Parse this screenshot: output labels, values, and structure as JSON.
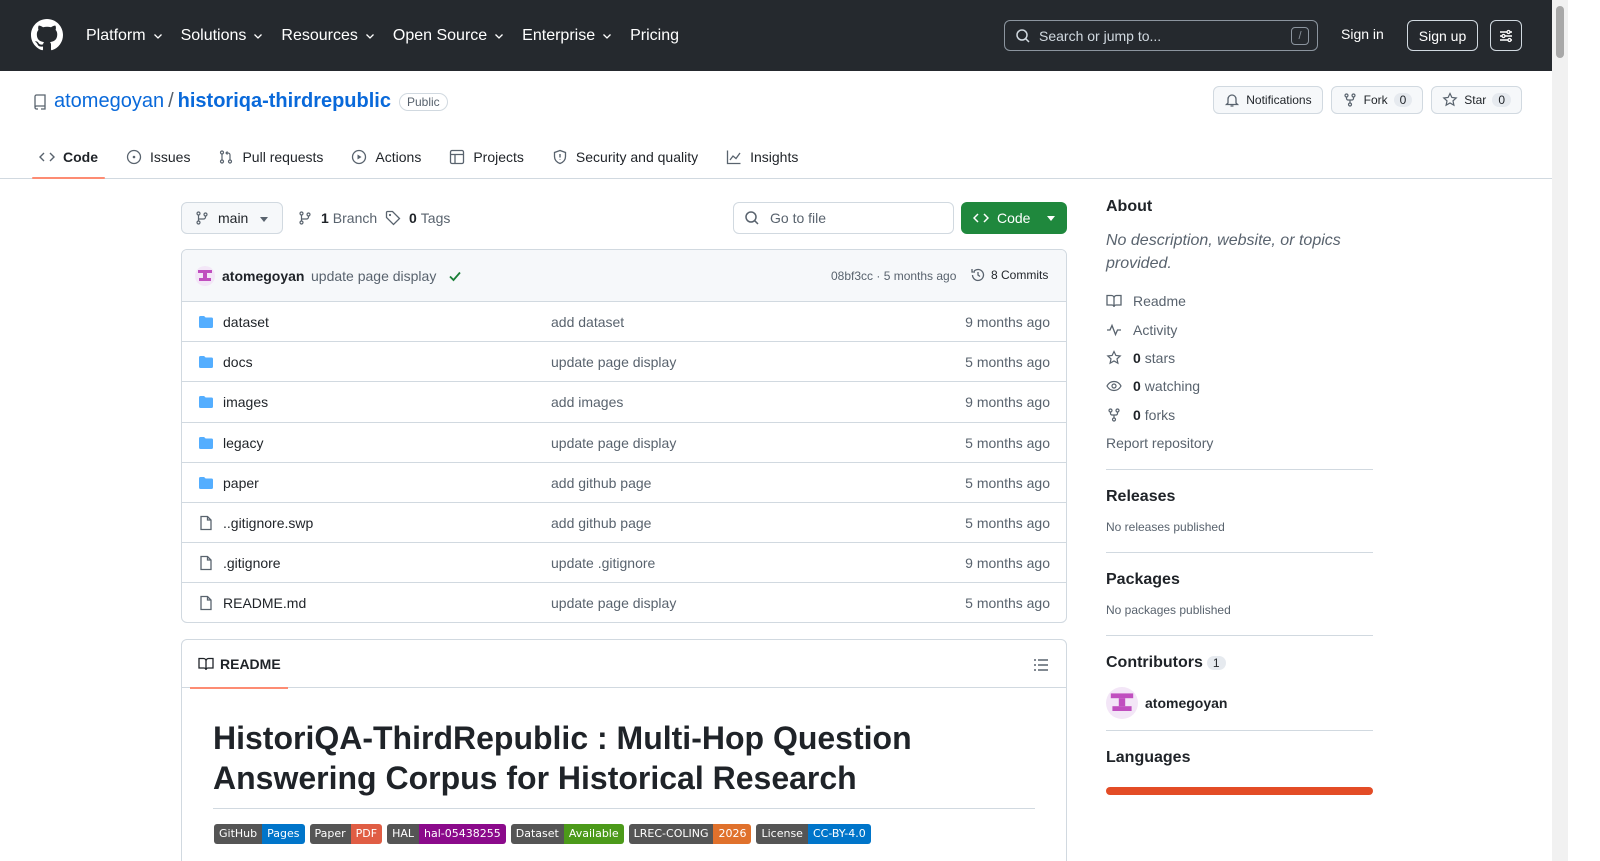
{
  "header": {
    "nav": [
      {
        "label": "Platform",
        "dropdown": true
      },
      {
        "label": "Solutions",
        "dropdown": true
      },
      {
        "label": "Resources",
        "dropdown": true
      },
      {
        "label": "Open Source",
        "dropdown": true
      },
      {
        "label": "Enterprise",
        "dropdown": true
      },
      {
        "label": "Pricing",
        "dropdown": false
      }
    ],
    "search_placeholder": "Search or jump to...",
    "search_key": "/",
    "sign_in": "Sign in",
    "sign_up": "Sign up"
  },
  "repo": {
    "owner": "atomegoyan",
    "separator": "/",
    "name": "historiqa-thirdrepublic",
    "visibility": "Public",
    "notifications_label": "Notifications",
    "fork_label": "Fork",
    "fork_count": "0",
    "star_label": "Star",
    "star_count": "0"
  },
  "tabs": [
    {
      "label": "Code",
      "icon": "code-icon",
      "active": true
    },
    {
      "label": "Issues",
      "icon": "issue-icon",
      "active": false
    },
    {
      "label": "Pull requests",
      "icon": "pull-request-icon",
      "active": false
    },
    {
      "label": "Actions",
      "icon": "play-icon",
      "active": false
    },
    {
      "label": "Projects",
      "icon": "table-icon",
      "active": false
    },
    {
      "label": "Security and quality",
      "icon": "shield-icon",
      "active": false
    },
    {
      "label": "Insights",
      "icon": "graph-icon",
      "active": false
    }
  ],
  "toolbar": {
    "branch": "main",
    "branch_count": "1",
    "branch_label": "Branch",
    "tag_count": "0",
    "tag_label": "Tags",
    "goto_placeholder": "Go to file",
    "code_label": "Code"
  },
  "commit": {
    "author": "atomegoyan",
    "message": "update page display",
    "hash_time": "08bf3cc · 5 months ago",
    "commits_label": "8 Commits"
  },
  "files": [
    {
      "type": "dir",
      "name": "dataset",
      "message": "add dataset",
      "time": "9 months ago"
    },
    {
      "type": "dir",
      "name": "docs",
      "message": "update page display",
      "time": "5 months ago"
    },
    {
      "type": "dir",
      "name": "images",
      "message": "add images",
      "time": "9 months ago"
    },
    {
      "type": "dir",
      "name": "legacy",
      "message": "update page display",
      "time": "5 months ago"
    },
    {
      "type": "dir",
      "name": "paper",
      "message": "add github page",
      "time": "5 months ago"
    },
    {
      "type": "file",
      "name": "..gitignore.swp",
      "message": "add github page",
      "time": "5 months ago"
    },
    {
      "type": "file",
      "name": ".gitignore",
      "message": "update .gitignore",
      "time": "9 months ago"
    },
    {
      "type": "file",
      "name": "README.md",
      "message": "update page display",
      "time": "5 months ago"
    }
  ],
  "readme": {
    "tab_label": "README",
    "title": "HistoriQA-ThirdRepublic : Multi-Hop Question Answering Corpus for Historical Research",
    "badges": [
      {
        "left": "GitHub",
        "right": "Pages",
        "color": "#0075ca"
      },
      {
        "left": "Paper",
        "right": "PDF",
        "color": "#e05d44"
      },
      {
        "left": "HAL",
        "right": "hal-05438255",
        "color": "#8b0a8b"
      },
      {
        "left": "Dataset",
        "right": "Available",
        "color": "#4c9a1a"
      },
      {
        "left": "LREC-COLING",
        "right": "2026",
        "color": "#e0712c"
      },
      {
        "left": "License",
        "right": "CC-BY-4.0",
        "color": "#0075ca"
      }
    ]
  },
  "sidebar": {
    "about_title": "About",
    "about_desc": "No description, website, or topics provided.",
    "links": [
      {
        "icon": "book-icon",
        "count": "",
        "label": "Readme"
      },
      {
        "icon": "pulse-icon",
        "count": "",
        "label": "Activity"
      },
      {
        "icon": "star-icon",
        "count": "0",
        "label": "stars"
      },
      {
        "icon": "eye-icon",
        "count": "0",
        "label": "watching"
      },
      {
        "icon": "fork-icon",
        "count": "0",
        "label": "forks"
      }
    ],
    "report": "Report repository",
    "releases_title": "Releases",
    "releases_text": "No releases published",
    "packages_title": "Packages",
    "packages_text": "No packages published",
    "contributors_title": "Contributors",
    "contributors_count": "1",
    "contributor_name": "atomegoyan",
    "languages_title": "Languages"
  }
}
